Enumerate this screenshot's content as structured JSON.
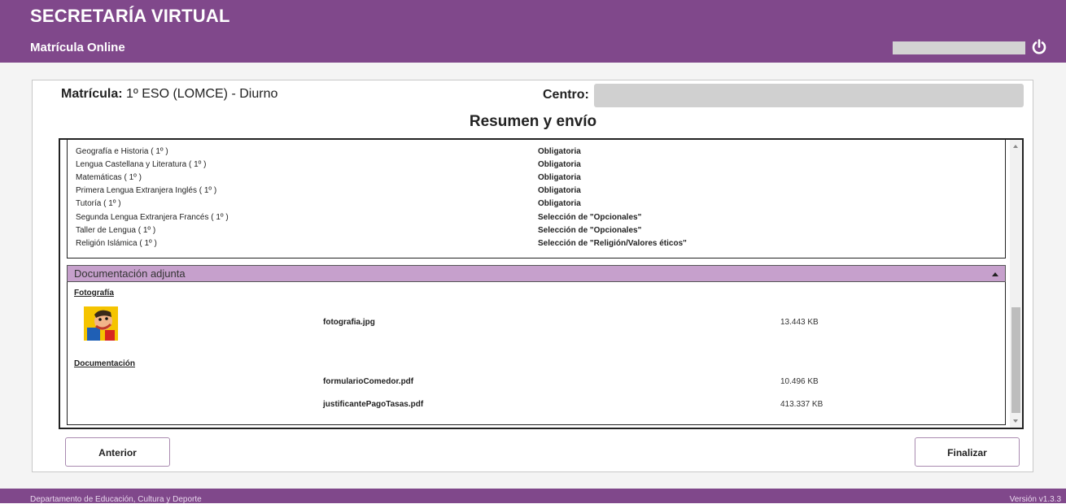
{
  "header": {
    "title": "SECRETARÍA VIRTUAL",
    "subtitle": "Matrícula Online",
    "power_icon": "power-icon"
  },
  "enrollment": {
    "label": "Matrícula:",
    "value": "1º ESO (LOMCE) - Diurno",
    "centro_label": "Centro:"
  },
  "section_title": "Resumen y envío",
  "subjects": [
    {
      "name": "Geografía e Historia ( 1º )",
      "type": "Obligatoria"
    },
    {
      "name": "Lengua Castellana y Literatura ( 1º )",
      "type": "Obligatoria"
    },
    {
      "name": "Matemáticas ( 1º )",
      "type": "Obligatoria"
    },
    {
      "name": "Primera Lengua Extranjera Inglés ( 1º )",
      "type": "Obligatoria"
    },
    {
      "name": "Tutoría ( 1º )",
      "type": "Obligatoria"
    },
    {
      "name": "Segunda Lengua Extranjera Francés ( 1º )",
      "type": "Selección de \"Opcionales\""
    },
    {
      "name": "Taller de Lengua ( 1º )",
      "type": "Selección de \"Opcionales\""
    },
    {
      "name": "Religión Islámica ( 1º )",
      "type": "Selección de \"Religión/Valores éticos\""
    }
  ],
  "docs": {
    "header": "Documentación adjunta",
    "photo_label": "Fotografía",
    "photo_file": {
      "name": "fotografia.jpg",
      "size": "13.443 KB"
    },
    "docs_label": "Documentación",
    "files": [
      {
        "name": "formularioComedor.pdf",
        "size": "10.496 KB"
      },
      {
        "name": "justificantePagoTasas.pdf",
        "size": "413.337 KB"
      }
    ]
  },
  "buttons": {
    "prev": "Anterior",
    "finish": "Finalizar"
  },
  "footer": {
    "left": "Departamento de Educación, Cultura y Deporte",
    "right": "Versión v1.3.3"
  },
  "colors": {
    "brand": "#80488b",
    "docs_header": "#c6a0cc"
  }
}
